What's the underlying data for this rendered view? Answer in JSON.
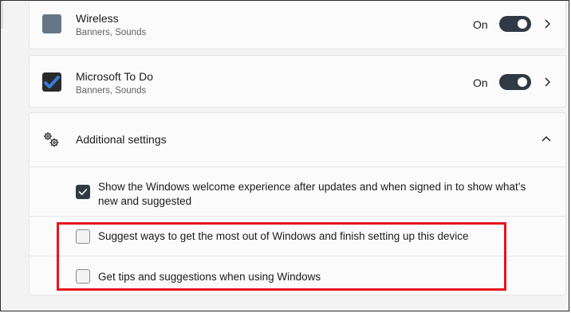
{
  "apps": [
    {
      "name": "Wireless",
      "subtitle": "Banners, Sounds",
      "state": "On",
      "icon": "wireless-app-icon",
      "icon_color": "#657786"
    },
    {
      "name": "Microsoft To Do",
      "subtitle": "Banners, Sounds",
      "state": "On",
      "icon": "microsoft-todo-icon",
      "icon_color": "#2564cf"
    }
  ],
  "additional_settings": {
    "title": "Additional settings",
    "expanded": true,
    "options": [
      {
        "label": "Show the Windows welcome experience after updates and when signed in to show what’s new and suggested",
        "checked": true
      },
      {
        "label": "Suggest ways to get the most out of Windows and finish setting up this device",
        "checked": false
      },
      {
        "label": "Get tips and suggestions when using Windows",
        "checked": false
      }
    ]
  },
  "colors": {
    "highlight": "#e8141e",
    "toggle_on": "#2f3a44",
    "background": "#f3f3f3"
  }
}
